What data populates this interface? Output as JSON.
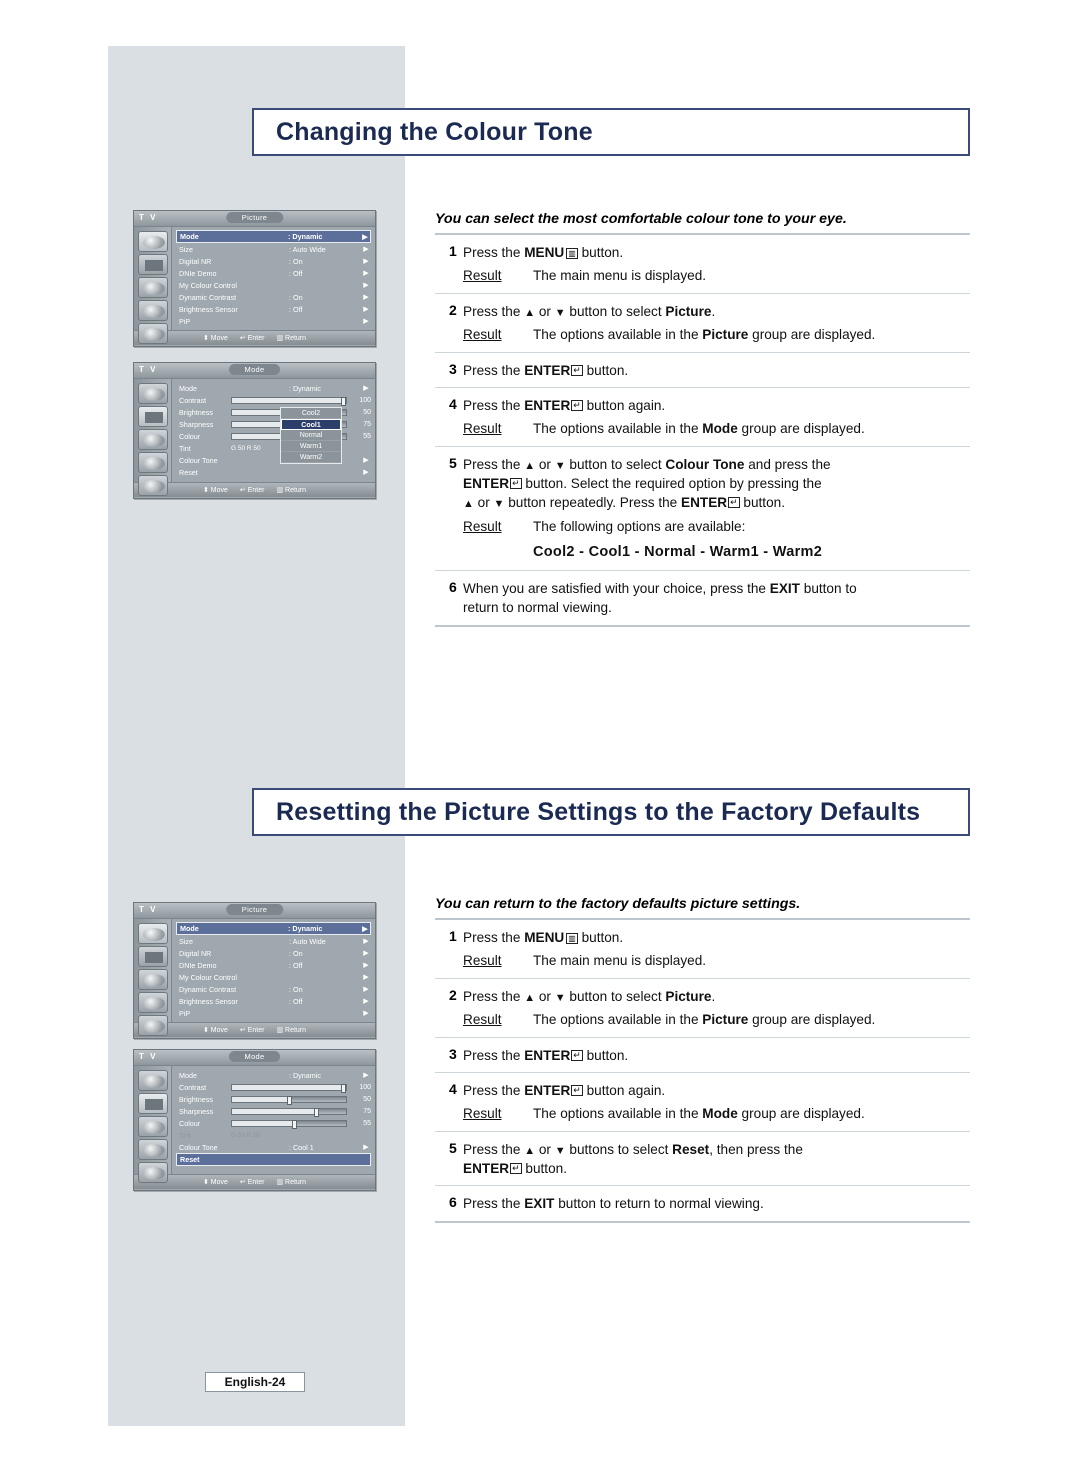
{
  "page": {
    "page_label": "English-24"
  },
  "sections": [
    {
      "title": "Changing the Colour Tone",
      "lead": "You can select the most comfortable colour tone to your eye.",
      "steps": [
        {
          "num": "1",
          "text_parts": [
            "Press the ",
            "MENU",
            " button."
          ],
          "result_label": "Result",
          "result": "The main menu is displayed."
        },
        {
          "num": "2",
          "text": "Press the ▲ or ▼ button to select Picture.",
          "result_label": "Result",
          "result": "The options available in the Picture group are displayed."
        },
        {
          "num": "3",
          "text": "Press the ENTER button."
        },
        {
          "num": "4",
          "text": "Press the ENTER button again.",
          "result_label": "Result",
          "result": "The options available in the Mode group are displayed."
        },
        {
          "num": "5",
          "text": "Press the ▲ or ▼ button to select Colour Tone and press the ENTER button. Select the required option by pressing the ▲ or ▼ button repeatedly. Press the ENTER button.",
          "result_label": "Result",
          "result": "The following options are available:",
          "options": "Cool2 - Cool1 - Normal - Warm1 - Warm2"
        },
        {
          "num": "6",
          "text": "When you are satisfied with your choice, press the EXIT button to return to normal viewing."
        }
      ]
    },
    {
      "title": "Resetting the Picture Settings to the Factory Defaults",
      "lead": "You can return to the factory defaults  picture settings.",
      "steps": [
        {
          "num": "1",
          "text": "Press the MENU button.",
          "result_label": "Result",
          "result": "The main menu is displayed."
        },
        {
          "num": "2",
          "text": "Press the ▲ or ▼ button to select Picture.",
          "result_label": "Result",
          "result": "The options available in the Picture group are displayed."
        },
        {
          "num": "3",
          "text": "Press the ENTER button."
        },
        {
          "num": "4",
          "text": "Press the ENTER button again.",
          "result_label": "Result",
          "result": "The options available in the Mode group are displayed."
        },
        {
          "num": "5",
          "text": "Press the ▲ or ▼ buttons to select Reset, then press the ENTER button."
        },
        {
          "num": "6",
          "text": "Press the EXIT button to return to normal viewing."
        }
      ]
    }
  ],
  "osd": {
    "tv_label": "T V",
    "footer": {
      "move": "Move",
      "enter": "Enter",
      "return": "Return"
    },
    "picture_menu": {
      "tab": "Picture",
      "rows": [
        {
          "label": "Mode",
          "value": ": Dynamic",
          "arrow": "▶",
          "highlight": true
        },
        {
          "label": "Size",
          "value": ": Auto Wide",
          "arrow": "▶"
        },
        {
          "label": "Digital NR",
          "value": ": On",
          "arrow": "▶"
        },
        {
          "label": "DNIe Demo",
          "value": ": Off",
          "arrow": "▶"
        },
        {
          "label": "My Colour Control",
          "value": "",
          "arrow": "▶"
        },
        {
          "label": "Dynamic Contrast",
          "value": ": On",
          "arrow": "▶"
        },
        {
          "label": "Brightness Sensor",
          "value": ": Off",
          "arrow": "▶"
        },
        {
          "label": "PiP",
          "value": "",
          "arrow": "▶"
        }
      ]
    },
    "mode_menu_tone": {
      "tab": "Mode",
      "rows": [
        {
          "label": "Mode",
          "value": ": Dynamic",
          "arrow": "▶"
        },
        {
          "label": "Contrast",
          "value": "100",
          "slider": 100
        },
        {
          "label": "Brightness",
          "value": "50",
          "slider": 50
        },
        {
          "label": "Sharpness",
          "value": "75",
          "slider": 75
        },
        {
          "label": "Colour",
          "value": "55",
          "slider": 55
        },
        {
          "label": "Tint",
          "value": "G 50        R 50",
          "slider": 50
        },
        {
          "label": "Colour Tone",
          "value": ": Cool 1",
          "arrow": "▶"
        },
        {
          "label": "Reset",
          "value": "",
          "arrow": "▶"
        }
      ],
      "dropdown": [
        "Cool2",
        "Cool1",
        "Normal",
        "Warm1",
        "Warm2"
      ],
      "dropdown_selected": "Cool1"
    },
    "mode_menu_reset": {
      "tab": "Mode",
      "rows": [
        {
          "label": "Mode",
          "value": ": Dynamic",
          "arrow": "▶"
        },
        {
          "label": "Contrast",
          "value": "100",
          "slider": 100
        },
        {
          "label": "Brightness",
          "value": "50",
          "slider": 50
        },
        {
          "label": "Sharpness",
          "value": "75",
          "slider": 75
        },
        {
          "label": "Colour",
          "value": "55",
          "slider": 55
        },
        {
          "label": "Tint",
          "value": "G 50        R 50",
          "slider": 50
        },
        {
          "label": "Colour Tone",
          "value": ": Cool 1",
          "arrow": "▶"
        },
        {
          "label": "Reset",
          "value": "",
          "arrow": "",
          "highlight": true
        }
      ]
    }
  }
}
